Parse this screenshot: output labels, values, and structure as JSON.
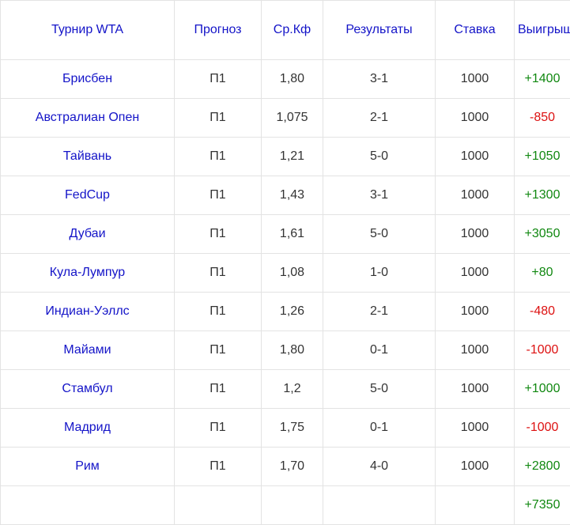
{
  "colors": {
    "header": "#1414c8",
    "text": "#333333",
    "win": "#118811",
    "loss": "#dd1111"
  },
  "headers": [
    "Турнир WTA",
    "Прогноз",
    "Ср.Кф",
    "Результаты",
    "Ставка",
    "Выигрыш"
  ],
  "rows": [
    {
      "tournament": "Брисбен",
      "forecast": "П1",
      "odds": "1,80",
      "result": "3-1",
      "stake": "1000",
      "win": "+1400",
      "sign": "pos"
    },
    {
      "tournament": "Австралиан Опен",
      "forecast": "П1",
      "odds": "1,075",
      "result": "2-1",
      "stake": "1000",
      "win": "-850",
      "sign": "neg"
    },
    {
      "tournament": "Тайвань",
      "forecast": "П1",
      "odds": "1,21",
      "result": "5-0",
      "stake": "1000",
      "win": "+1050",
      "sign": "pos"
    },
    {
      "tournament": "FedCup",
      "forecast": "П1",
      "odds": "1,43",
      "result": "3-1",
      "stake": "1000",
      "win": "+1300",
      "sign": "pos"
    },
    {
      "tournament": "Дубаи",
      "forecast": "П1",
      "odds": "1,61",
      "result": "5-0",
      "stake": "1000",
      "win": "+3050",
      "sign": "pos"
    },
    {
      "tournament": "Кула-Лумпур",
      "forecast": "П1",
      "odds": "1,08",
      "result": "1-0",
      "stake": "1000",
      "win": "+80",
      "sign": "pos"
    },
    {
      "tournament": "Индиан-Уэллс",
      "forecast": "П1",
      "odds": "1,26",
      "result": "2-1",
      "stake": "1000",
      "win": "-480",
      "sign": "neg"
    },
    {
      "tournament": "Майами",
      "forecast": "П1",
      "odds": "1,80",
      "result": "0-1",
      "stake": "1000",
      "win": "-1000",
      "sign": "neg"
    },
    {
      "tournament": "Стамбул",
      "forecast": "П1",
      "odds": "1,2",
      "result": "5-0",
      "stake": "1000",
      "win": "+1000",
      "sign": "pos"
    },
    {
      "tournament": "Мадрид",
      "forecast": "П1",
      "odds": "1,75",
      "result": "0-1",
      "stake": "1000",
      "win": "-1000",
      "sign": "neg"
    },
    {
      "tournament": "Рим",
      "forecast": "П1",
      "odds": "1,70",
      "result": "4-0",
      "stake": "1000",
      "win": "+2800",
      "sign": "pos"
    }
  ],
  "total": {
    "win": "+7350",
    "sign": "pos"
  }
}
